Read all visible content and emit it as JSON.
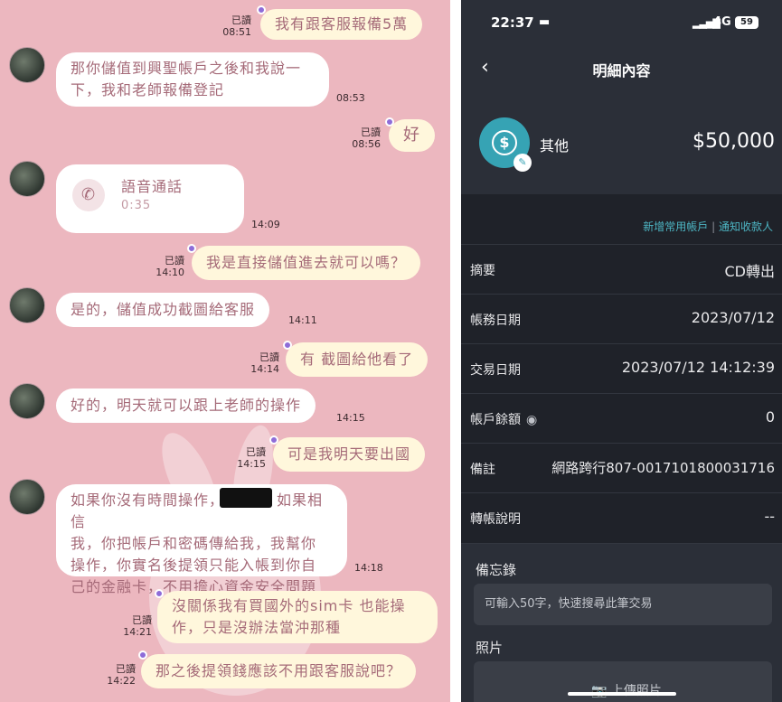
{
  "chat": {
    "messages": [
      {
        "text": "我有跟客服報備5萬",
        "read": "已讀",
        "time": "08:51"
      },
      {
        "text_line1": "那你儲值到興聖帳戶之後和我說一",
        "text_line2": "下，我和老師報備登記",
        "time": "08:53"
      },
      {
        "text": "好",
        "read": "已讀",
        "time": "08:56"
      },
      {
        "call_title": "語音通話",
        "call_duration": "0:35",
        "time": "14:09"
      },
      {
        "text": "我是直接儲值進去就可以嗎？",
        "read": "已讀",
        "time": "14:10"
      },
      {
        "text": "是的，儲值成功截圖給客服",
        "time": "14:11"
      },
      {
        "text": "有 截圖給他看了",
        "read": "已讀",
        "time": "14:14"
      },
      {
        "text": "好的，明天就可以跟上老師的操作",
        "time": "14:15"
      },
      {
        "text": "可是我明天要出國",
        "read": "已讀",
        "time": "14:15"
      },
      {
        "text_line1": "如果你沒有時間操作，",
        "text_line1b": "如果相信",
        "text_line2": "我，你把帳戶和密碼傳給我，我幫你",
        "text_line3": "操作，你實名後提領只能入帳到你自",
        "text_line4": "己的金融卡，不用擔心資金安全問題",
        "time": "14:18"
      },
      {
        "text_line1": "沒關係我有買國外的sim卡 也能操",
        "text_line2": "作，只是沒辦法當沖那種",
        "read": "已讀",
        "time": "14:21"
      },
      {
        "text": "那之後提領錢應該不用跟客服說吧？",
        "read": "已讀",
        "time": "14:22"
      }
    ]
  },
  "bank": {
    "status": {
      "time": "22:37",
      "network": "4G",
      "battery": "59"
    },
    "header": {
      "title": "明細內容",
      "back_icon": "chevron-left-icon"
    },
    "account": {
      "name": "其他",
      "amount": "$50,000"
    },
    "links": {
      "add": "新增常用帳戶",
      "sep": " | ",
      "notify": "通知收款人"
    },
    "rows": [
      {
        "label": "摘要",
        "value": "CD轉出"
      },
      {
        "label": "帳務日期",
        "value": "2023/07/12"
      },
      {
        "label": "交易日期",
        "value": "2023/07/12 14:12:39"
      },
      {
        "label": "帳戶餘額",
        "value": "0"
      },
      {
        "label": "備註",
        "value": "網路跨行807-0017101800031716"
      },
      {
        "label": "轉帳說明",
        "value": "--"
      }
    ],
    "memo": {
      "title": "備忘錄",
      "placeholder": "可輸入50字，快速搜尋此筆交易"
    },
    "photo": {
      "title": "照片",
      "upload": "上傳照片"
    }
  },
  "colors": {
    "chat_bg": "#ecb7bf",
    "bank_bg": "#1f2229",
    "accent": "#36a3b4"
  }
}
